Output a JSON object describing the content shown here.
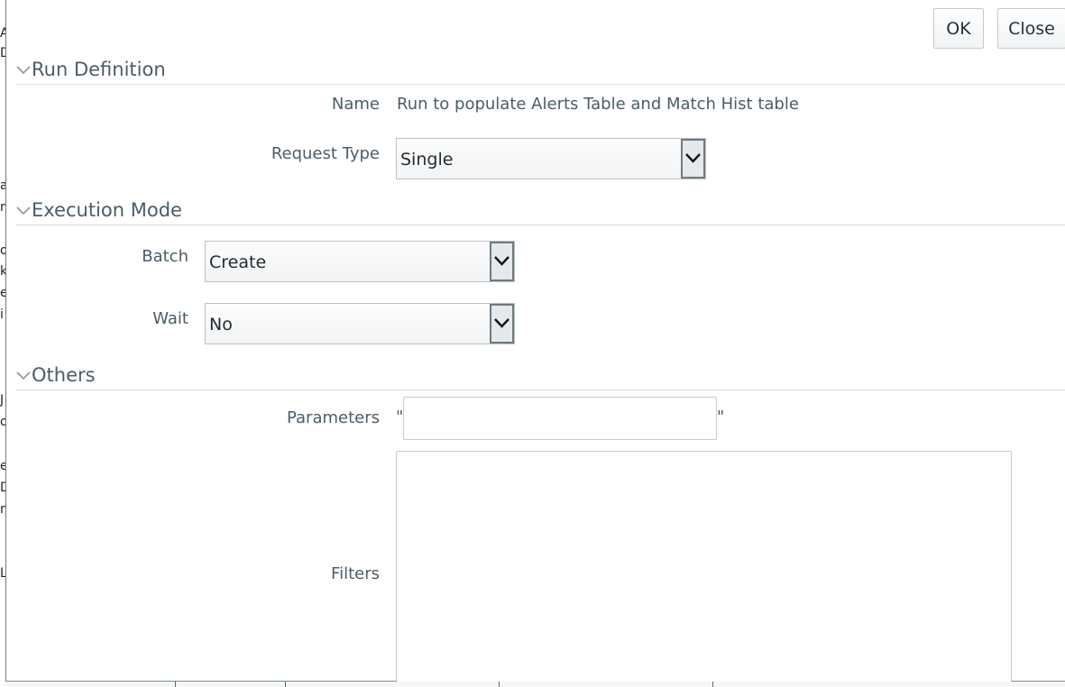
{
  "background": {
    "strip_chars": [
      "A",
      "D",
      "a",
      "n",
      "o",
      "k",
      "e",
      "i",
      "J",
      "o",
      "e",
      "D",
      "n",
      "L"
    ]
  },
  "toolbar": {
    "ok_label": "OK",
    "close_label": "Close"
  },
  "sections": {
    "run_definition": {
      "title": "Run Definition",
      "name_label": "Name",
      "name_value": "Run to populate Alerts Table and Match Hist table",
      "request_type_label": "Request Type",
      "request_type_value": "Single"
    },
    "execution_mode": {
      "title": "Execution Mode",
      "batch_label": "Batch",
      "batch_value": "Create",
      "wait_label": "Wait",
      "wait_value": "No"
    },
    "others": {
      "title": "Others",
      "parameters_label": "Parameters",
      "parameters_value": "",
      "quote_open": "\"",
      "quote_close": "\"",
      "filters_label": "Filters",
      "filters_value": ""
    }
  },
  "icons": {
    "section_toggle": "chevron-down-icon",
    "select_arrow": "chevron-down-icon"
  },
  "colors": {
    "label_text": "#4a5d66",
    "border": "#c7ccd0",
    "section_rule": "#d9dee1"
  }
}
